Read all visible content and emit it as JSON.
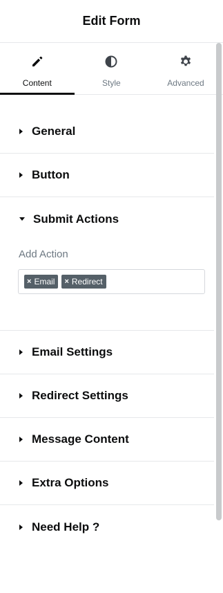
{
  "header": {
    "title": "Edit Form"
  },
  "tabs": [
    {
      "label": "Content",
      "icon": "pencil-icon",
      "active": true
    },
    {
      "label": "Style",
      "icon": "contrast-icon",
      "active": false
    },
    {
      "label": "Advanced",
      "icon": "gear-icon",
      "active": false
    }
  ],
  "sections": {
    "general": "General",
    "button": "Button",
    "submit_actions": "Submit Actions",
    "email_settings": "Email Settings",
    "redirect_settings": "Redirect Settings",
    "message_content": "Message Content",
    "extra_options": "Extra Options",
    "need_help": "Need Help ?"
  },
  "submit_actions": {
    "field_label": "Add Action",
    "tags": [
      {
        "x": "×",
        "label": "Email"
      },
      {
        "x": "×",
        "label": "Redirect"
      }
    ]
  }
}
